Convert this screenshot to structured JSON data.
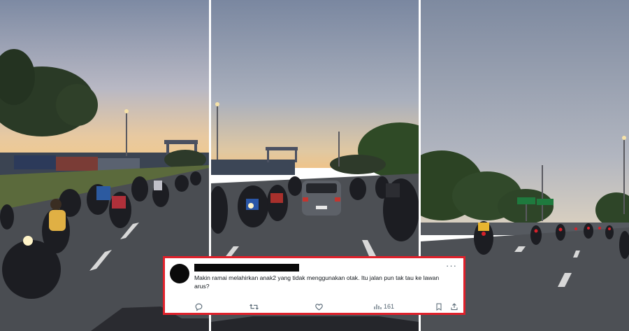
{
  "panels": [
    {
      "name": "left-photo",
      "description_icon": "motorcycles-highway-photo"
    },
    {
      "name": "middle-photo",
      "description_icon": "motorcycles-highway-photo"
    },
    {
      "name": "right-photo",
      "description_icon": "motorcycles-highway-photo"
    }
  ],
  "tweet": {
    "author": "",
    "text": "Makin ramai melahirkan anak2 yang tidak menggunakan otak. Itu jalan pun tak tau ke lawan arus?",
    "views": "161",
    "more_icon": "more-icon",
    "icons": [
      "reply-icon",
      "retweet-icon",
      "like-icon",
      "views-icon",
      "bookmark-icon",
      "share-icon"
    ]
  },
  "colors": {
    "highlight_border": "#e0212b",
    "icon_gray": "#536471",
    "text": "#0f1419"
  }
}
